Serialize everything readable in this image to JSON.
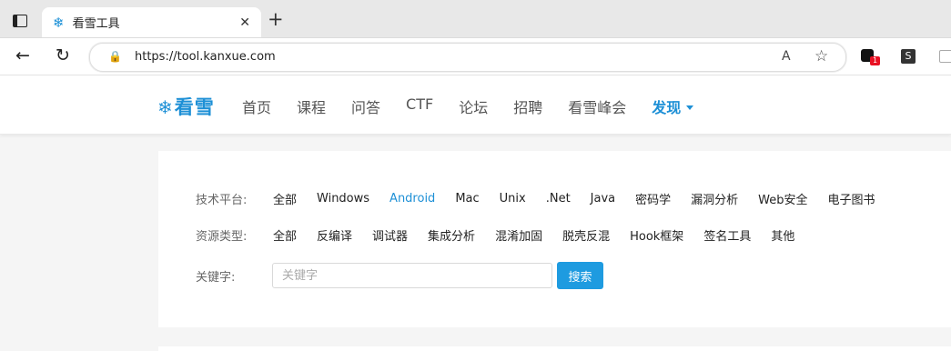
{
  "browser": {
    "tab_title": "看雪工具",
    "url": "https://tool.kanxue.com",
    "ext_badge": "1",
    "ext_s_label": "S"
  },
  "site": {
    "logo_text": "看雪",
    "nav": [
      "首页",
      "课程",
      "问答",
      "CTF",
      "论坛",
      "招聘",
      "看雪峰会"
    ],
    "nav_active": "发现",
    "accent_color": "#1e90d6"
  },
  "filters": {
    "platform_label": "技术平台:",
    "platform_options": [
      "全部",
      "Windows",
      "Android",
      "Mac",
      "Unix",
      ".Net",
      "Java",
      "密码学",
      "漏洞分析",
      "Web安全",
      "电子图书"
    ],
    "platform_selected": "Android",
    "resource_label": "资源类型:",
    "resource_options": [
      "全部",
      "反编译",
      "调试器",
      "集成分析",
      "混淆加固",
      "脱壳反混",
      "Hook框架",
      "签名工具",
      "其他"
    ],
    "keyword_label": "关键字:",
    "keyword_placeholder": "关键字",
    "search_button": "搜索"
  }
}
